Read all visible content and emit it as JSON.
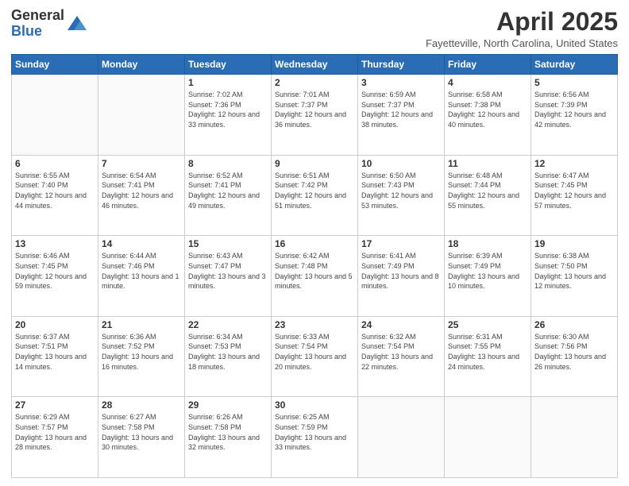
{
  "header": {
    "logo_general": "General",
    "logo_blue": "Blue",
    "title": "April 2025",
    "location": "Fayetteville, North Carolina, United States"
  },
  "days_of_week": [
    "Sunday",
    "Monday",
    "Tuesday",
    "Wednesday",
    "Thursday",
    "Friday",
    "Saturday"
  ],
  "weeks": [
    [
      {
        "day": "",
        "info": ""
      },
      {
        "day": "",
        "info": ""
      },
      {
        "day": "1",
        "info": "Sunrise: 7:02 AM\nSunset: 7:36 PM\nDaylight: 12 hours and 33 minutes."
      },
      {
        "day": "2",
        "info": "Sunrise: 7:01 AM\nSunset: 7:37 PM\nDaylight: 12 hours and 36 minutes."
      },
      {
        "day": "3",
        "info": "Sunrise: 6:59 AM\nSunset: 7:37 PM\nDaylight: 12 hours and 38 minutes."
      },
      {
        "day": "4",
        "info": "Sunrise: 6:58 AM\nSunset: 7:38 PM\nDaylight: 12 hours and 40 minutes."
      },
      {
        "day": "5",
        "info": "Sunrise: 6:56 AM\nSunset: 7:39 PM\nDaylight: 12 hours and 42 minutes."
      }
    ],
    [
      {
        "day": "6",
        "info": "Sunrise: 6:55 AM\nSunset: 7:40 PM\nDaylight: 12 hours and 44 minutes."
      },
      {
        "day": "7",
        "info": "Sunrise: 6:54 AM\nSunset: 7:41 PM\nDaylight: 12 hours and 46 minutes."
      },
      {
        "day": "8",
        "info": "Sunrise: 6:52 AM\nSunset: 7:41 PM\nDaylight: 12 hours and 49 minutes."
      },
      {
        "day": "9",
        "info": "Sunrise: 6:51 AM\nSunset: 7:42 PM\nDaylight: 12 hours and 51 minutes."
      },
      {
        "day": "10",
        "info": "Sunrise: 6:50 AM\nSunset: 7:43 PM\nDaylight: 12 hours and 53 minutes."
      },
      {
        "day": "11",
        "info": "Sunrise: 6:48 AM\nSunset: 7:44 PM\nDaylight: 12 hours and 55 minutes."
      },
      {
        "day": "12",
        "info": "Sunrise: 6:47 AM\nSunset: 7:45 PM\nDaylight: 12 hours and 57 minutes."
      }
    ],
    [
      {
        "day": "13",
        "info": "Sunrise: 6:46 AM\nSunset: 7:45 PM\nDaylight: 12 hours and 59 minutes."
      },
      {
        "day": "14",
        "info": "Sunrise: 6:44 AM\nSunset: 7:46 PM\nDaylight: 13 hours and 1 minute."
      },
      {
        "day": "15",
        "info": "Sunrise: 6:43 AM\nSunset: 7:47 PM\nDaylight: 13 hours and 3 minutes."
      },
      {
        "day": "16",
        "info": "Sunrise: 6:42 AM\nSunset: 7:48 PM\nDaylight: 13 hours and 5 minutes."
      },
      {
        "day": "17",
        "info": "Sunrise: 6:41 AM\nSunset: 7:49 PM\nDaylight: 13 hours and 8 minutes."
      },
      {
        "day": "18",
        "info": "Sunrise: 6:39 AM\nSunset: 7:49 PM\nDaylight: 13 hours and 10 minutes."
      },
      {
        "day": "19",
        "info": "Sunrise: 6:38 AM\nSunset: 7:50 PM\nDaylight: 13 hours and 12 minutes."
      }
    ],
    [
      {
        "day": "20",
        "info": "Sunrise: 6:37 AM\nSunset: 7:51 PM\nDaylight: 13 hours and 14 minutes."
      },
      {
        "day": "21",
        "info": "Sunrise: 6:36 AM\nSunset: 7:52 PM\nDaylight: 13 hours and 16 minutes."
      },
      {
        "day": "22",
        "info": "Sunrise: 6:34 AM\nSunset: 7:53 PM\nDaylight: 13 hours and 18 minutes."
      },
      {
        "day": "23",
        "info": "Sunrise: 6:33 AM\nSunset: 7:54 PM\nDaylight: 13 hours and 20 minutes."
      },
      {
        "day": "24",
        "info": "Sunrise: 6:32 AM\nSunset: 7:54 PM\nDaylight: 13 hours and 22 minutes."
      },
      {
        "day": "25",
        "info": "Sunrise: 6:31 AM\nSunset: 7:55 PM\nDaylight: 13 hours and 24 minutes."
      },
      {
        "day": "26",
        "info": "Sunrise: 6:30 AM\nSunset: 7:56 PM\nDaylight: 13 hours and 26 minutes."
      }
    ],
    [
      {
        "day": "27",
        "info": "Sunrise: 6:29 AM\nSunset: 7:57 PM\nDaylight: 13 hours and 28 minutes."
      },
      {
        "day": "28",
        "info": "Sunrise: 6:27 AM\nSunset: 7:58 PM\nDaylight: 13 hours and 30 minutes."
      },
      {
        "day": "29",
        "info": "Sunrise: 6:26 AM\nSunset: 7:58 PM\nDaylight: 13 hours and 32 minutes."
      },
      {
        "day": "30",
        "info": "Sunrise: 6:25 AM\nSunset: 7:59 PM\nDaylight: 13 hours and 33 minutes."
      },
      {
        "day": "",
        "info": ""
      },
      {
        "day": "",
        "info": ""
      },
      {
        "day": "",
        "info": ""
      }
    ]
  ]
}
